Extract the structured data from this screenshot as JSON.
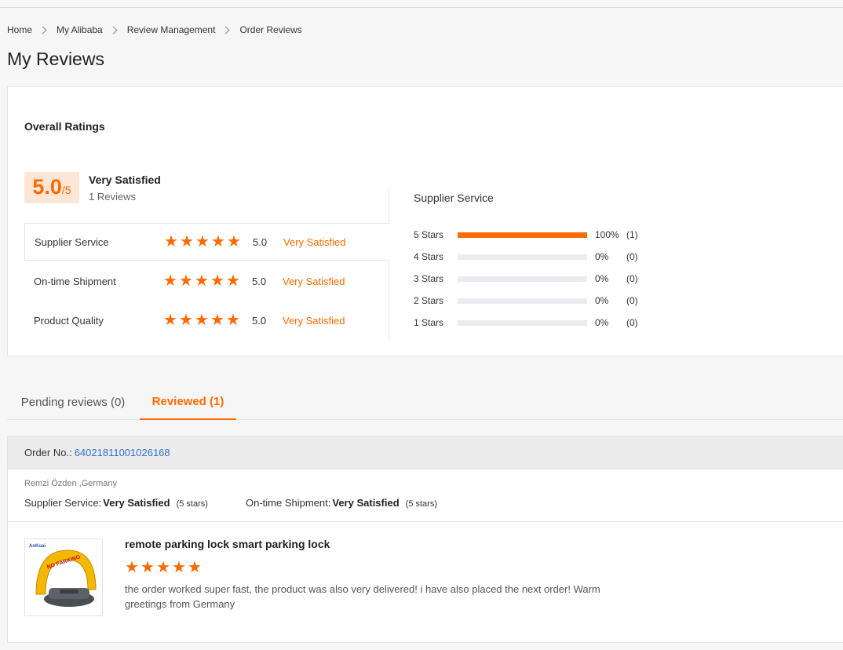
{
  "breadcrumb": [
    "Home",
    "My Alibaba",
    "Review Management",
    "Order Reviews"
  ],
  "page_title": "My Reviews",
  "overall": {
    "title": "Overall Ratings",
    "score": "5.0",
    "score_max": "/5",
    "label": "Very Satisfied",
    "count": "1 Reviews",
    "rows": [
      {
        "name": "Supplier Service",
        "value": "5.0",
        "level": "Very Satisfied",
        "stars": 5
      },
      {
        "name": "On-time Shipment",
        "value": "5.0",
        "level": "Very Satisfied",
        "stars": 5
      },
      {
        "name": "Product Quality",
        "value": "5.0",
        "level": "Very Satisfied",
        "stars": 5
      }
    ]
  },
  "distribution": {
    "title": "Supplier Service",
    "rows": [
      {
        "label": "5  Stars",
        "fraction": 1.0,
        "pct": "100%",
        "count": "(1)"
      },
      {
        "label": "4  Stars",
        "fraction": 0,
        "pct": "0%",
        "count": "(0)"
      },
      {
        "label": "3  Stars",
        "fraction": 0,
        "pct": "0%",
        "count": "(0)"
      },
      {
        "label": "2  Stars",
        "fraction": 0,
        "pct": "0%",
        "count": "(0)"
      },
      {
        "label": "1  Stars",
        "fraction": 0,
        "pct": "0%",
        "count": "(0)"
      }
    ]
  },
  "tabs": {
    "pending": "Pending reviews (0)",
    "reviewed": "Reviewed (1)"
  },
  "order": {
    "label": "Order No.:",
    "number": "64021811001026168",
    "buyer": "Remzi Özden ,Germany",
    "supplier_label": "Supplier Service:",
    "supplier_value": "Very Satisfied",
    "supplier_stars": "(5 stars)",
    "shipment_label": "On-time Shipment:",
    "shipment_value": "Very Satisfied",
    "shipment_stars": "(5 stars)",
    "product_name": "remote parking lock smart parking lock",
    "product_brand": "AnKuai",
    "product_sign": "NO PARKING",
    "review_stars": 5,
    "review_text": "the order worked super fast, the product was also very delivered!  i have also placed the next order!  Warm greetings from Germany"
  },
  "colors": {
    "accent": "#ff6a00",
    "link": "#2e74c0"
  }
}
